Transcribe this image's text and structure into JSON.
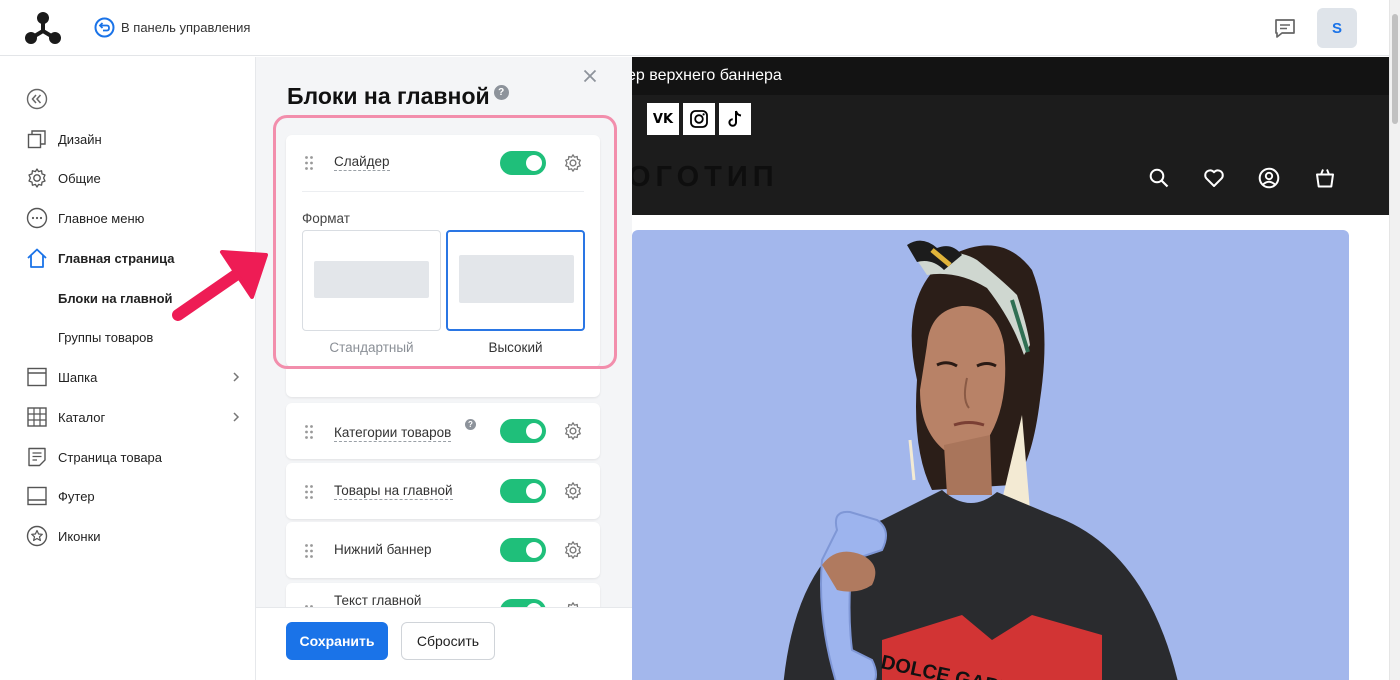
{
  "topbar": {
    "back_label": "В панель управления",
    "avatar_letter": "S"
  },
  "sidebar": {
    "items": [
      {
        "label": "Дизайн",
        "icon": "design-icon"
      },
      {
        "label": "Общие",
        "icon": "gear-icon"
      },
      {
        "label": "Главное меню",
        "icon": "menu-dots-icon"
      },
      {
        "label": "Главная страница",
        "icon": "home-icon"
      },
      {
        "label": "Блоки на главной"
      },
      {
        "label": "Группы товаров"
      },
      {
        "label": "Шапка",
        "icon": "header-layout-icon"
      },
      {
        "label": "Каталог",
        "icon": "grid-icon"
      },
      {
        "label": "Страница товара",
        "icon": "product-page-icon"
      },
      {
        "label": "Футер",
        "icon": "footer-layout-icon"
      },
      {
        "label": "Иконки",
        "icon": "star-icon"
      }
    ]
  },
  "panel": {
    "title": "Блоки на главной",
    "help": "?",
    "slider": {
      "label": "Слайдер",
      "enabled": true,
      "format_label": "Формат",
      "options": [
        {
          "label": "Стандартный",
          "selected": false
        },
        {
          "label": "Высокий",
          "selected": true
        }
      ]
    },
    "blocks": [
      {
        "label": "Категории товаров",
        "enabled": true
      },
      {
        "label": "Товары на главной",
        "enabled": true
      },
      {
        "label": "Нижний баннер",
        "enabled": true
      },
      {
        "label": "Текст главной",
        "enabled": true
      }
    ],
    "save_label": "Сохранить",
    "reset_label": "Сбросить"
  },
  "preview": {
    "banner_text": "ер верхнего баннера",
    "vk_label": "VK",
    "logo_text": "ОГОТИП",
    "shirt_text": "DOLCE GABBANA"
  },
  "colors": {
    "accent": "#1a73e8",
    "toggle_on": "#1fbf7a",
    "highlight": "#f28eac",
    "arrow": "#ee1c55",
    "hero_bg": "#a3b7ec"
  }
}
